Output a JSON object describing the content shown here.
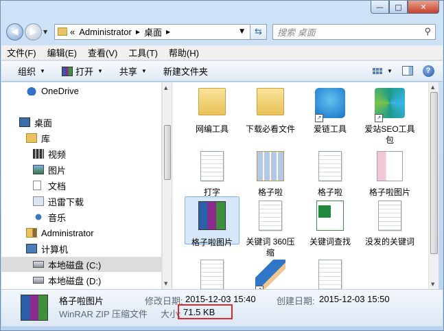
{
  "window": {
    "minimize_label": "—",
    "maximize_label": "□",
    "close_label": "✕"
  },
  "nav": {
    "back_arrow": "◀",
    "forward_arrow": "▶",
    "address": {
      "overflow": "«",
      "crumbs": [
        "Administrator",
        "桌面"
      ]
    },
    "search_placeholder": "搜索 桌面"
  },
  "menubar": [
    "文件(F)",
    "编辑(E)",
    "查看(V)",
    "工具(T)",
    "帮助(H)"
  ],
  "toolbar": {
    "organize": "组织",
    "open": "打开",
    "share": "共享",
    "new_folder": "新建文件夹"
  },
  "navpane": {
    "items": [
      {
        "label": "OneDrive",
        "icon": "cloud-icon"
      },
      {
        "label": "桌面",
        "icon": "desktop-icon"
      },
      {
        "label": "库",
        "icon": "library-icon"
      },
      {
        "label": "视频",
        "icon": "video-icon"
      },
      {
        "label": "图片",
        "icon": "picture-icon"
      },
      {
        "label": "文档",
        "icon": "document-icon"
      },
      {
        "label": "迅雷下载",
        "icon": "thunder-download-icon"
      },
      {
        "label": "音乐",
        "icon": "music-icon"
      },
      {
        "label": "Administrator",
        "icon": "user-folder-icon"
      },
      {
        "label": "计算机",
        "icon": "computer-icon"
      },
      {
        "label": "本地磁盘 (C:)",
        "icon": "drive-icon"
      },
      {
        "label": "本地磁盘 (D:)",
        "icon": "drive-icon"
      }
    ]
  },
  "files": [
    {
      "label": "网编工具",
      "icon": "folder-icon"
    },
    {
      "label": "下载必看文件",
      "icon": "folder-icon"
    },
    {
      "label": "爱链工具",
      "icon": "app-shortcut-icon"
    },
    {
      "label": "爱站SEO工具包",
      "icon": "app-shortcut-icon"
    },
    {
      "label": "打字",
      "icon": "text-document-icon"
    },
    {
      "label": "格子啦",
      "icon": "image-document-icon"
    },
    {
      "label": "格子啦",
      "icon": "text-document-icon"
    },
    {
      "label": "格子啦图片",
      "icon": "image-document-icon"
    },
    {
      "label": "格子啦图片",
      "icon": "winrar-archive-icon"
    },
    {
      "label": "关键词 360压缩",
      "icon": "text-document-icon"
    },
    {
      "label": "关键词查找",
      "icon": "excel-document-icon"
    },
    {
      "label": "没发的关键词",
      "icon": "text-document-icon"
    },
    {
      "label": "",
      "icon": "text-document-icon"
    },
    {
      "label": "",
      "icon": "pencil-shortcut-icon"
    },
    {
      "label": "",
      "icon": "text-document-icon"
    }
  ],
  "details": {
    "name": "格子啦图片",
    "type": "WinRAR ZIP 压缩文件",
    "modified_label": "修改日期:",
    "modified_value": "2015-12-03 15:40",
    "created_label": "创建日期:",
    "created_value": "2015-12-03 15:50",
    "size_label": "大小:",
    "size_value": "71.5 KB"
  }
}
